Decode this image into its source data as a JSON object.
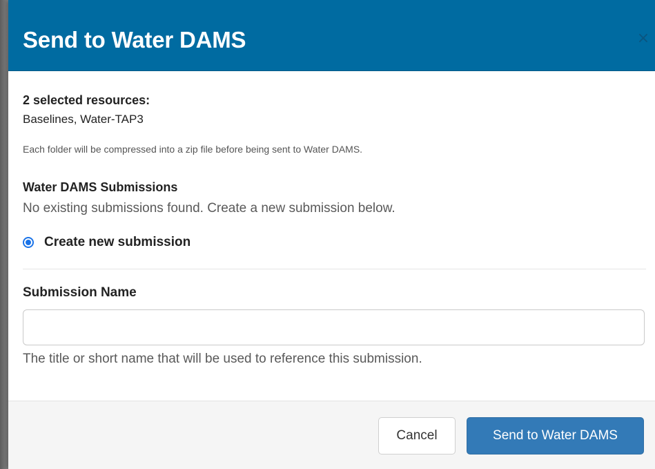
{
  "modal": {
    "title": "Send to Water DAMS",
    "close_glyph": "×"
  },
  "resources": {
    "heading": "2 selected resources:",
    "list": "Baselines, Water-TAP3",
    "note": "Each folder will be compressed into a zip file before being sent to Water DAMS."
  },
  "submissions": {
    "heading": "Water DAMS Submissions",
    "empty_message": "No existing submissions found. Create a new submission below.",
    "option_label": "Create new submission",
    "option_selected": true
  },
  "form": {
    "name_label": "Submission Name",
    "name_value": "",
    "name_placeholder": "",
    "help_text": "The title or short name that will be used to reference this submission."
  },
  "footer": {
    "cancel_label": "Cancel",
    "submit_label": "Send to Water DAMS"
  },
  "colors": {
    "header_bg": "#006ba1",
    "primary_button": "#337ab7",
    "radio_accent": "#1a73e8"
  },
  "icons": {
    "close": "close-icon",
    "radio": "radio-selected-icon"
  }
}
